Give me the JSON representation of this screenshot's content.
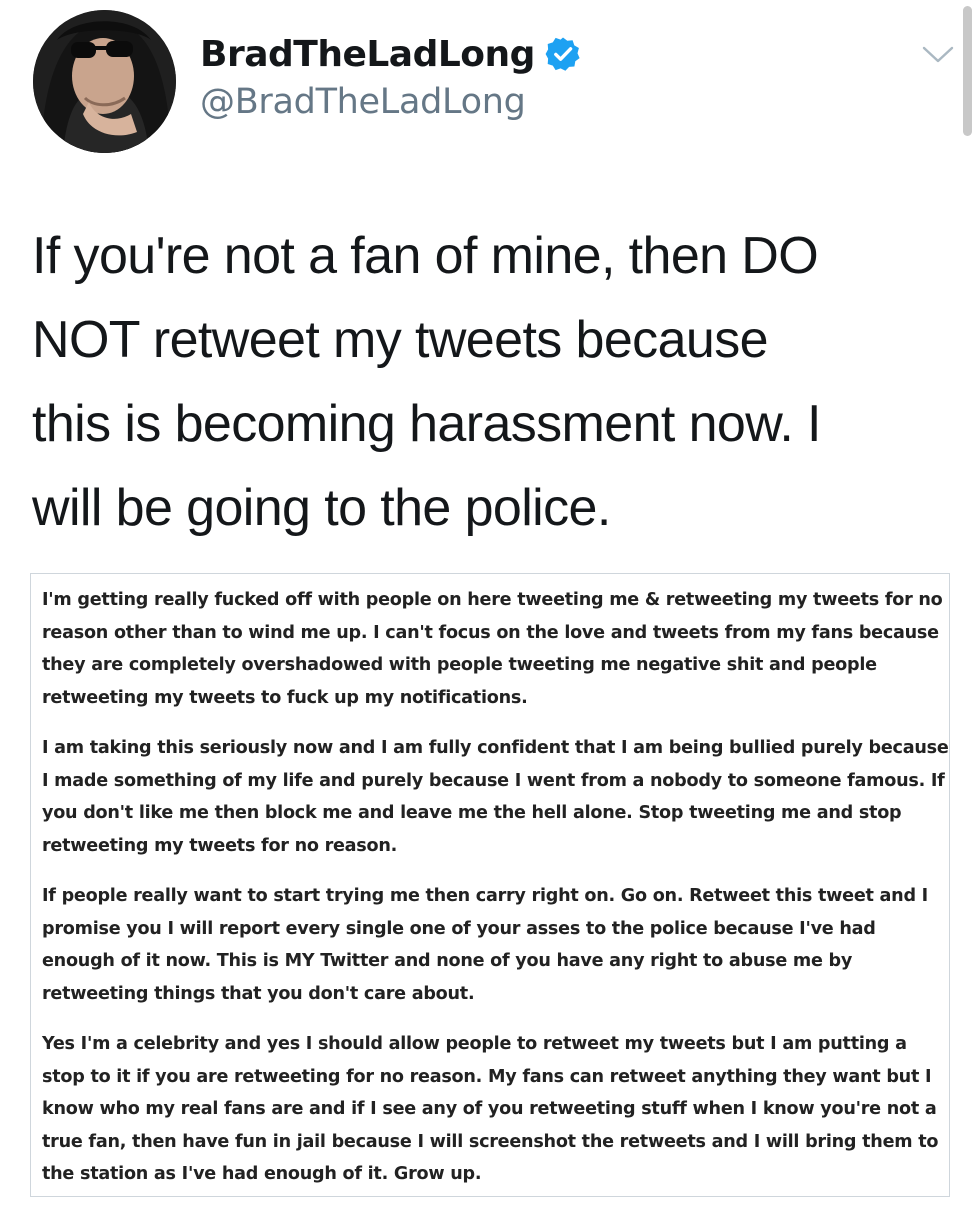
{
  "tweet": {
    "author": {
      "display_name": "BradTheLadLong",
      "handle": "@BradTheLadLong",
      "verified": true,
      "verified_icon": "verified-badge-icon",
      "avatar": "profile-avatar"
    },
    "menu_icon": "chevron-down-icon",
    "text_lines": [
      "If you're not a fan of mine, then DO",
      "NOT retweet my tweets because",
      "this is becoming harassment now. I",
      "will be going to the police."
    ]
  },
  "attached_note": {
    "paragraphs": [
      [
        "I'm getting really fucked off with people on here tweeting me & retweeting my tweets for no",
        "reason other than to wind me up. I can't focus on the love and tweets from my fans because",
        "they are completely overshadowed with people tweeting me negative shit and people",
        "retweeting my tweets to fuck up my notifications."
      ],
      [
        "I am taking this seriously now and I am fully confident that I am being bullied purely because",
        "I made something of my life and purely because I went from a nobody to someone famous. If",
        "you don't like me then block me and leave me the hell alone. Stop tweeting me and stop",
        "retweeting my tweets for no reason."
      ],
      [
        "If people really want to start trying me then carry right on. Go on. Retweet this tweet and I",
        "promise you I will report every single one of your asses to the police because I've had",
        "enough of it now. This is MY Twitter and none of you have any right to abuse me by",
        "retweeting things that you don't care about."
      ],
      [
        "Yes I'm a celebrity and yes I should allow people to retweet my tweets but I am putting a",
        "stop to it if you are retweeting for no reason. My fans can retweet anything they want but I",
        "know who my real fans are and if I see any of you retweeting stuff when I know you're not a",
        "true fan, then have fun in jail because I will screenshot the retweets and I will bring them to",
        "the station as I've had enough of it. Grow up."
      ]
    ]
  },
  "colors": {
    "verified_blue": "#1da1f2",
    "handle_gray": "#657786",
    "text": "#14171a"
  }
}
